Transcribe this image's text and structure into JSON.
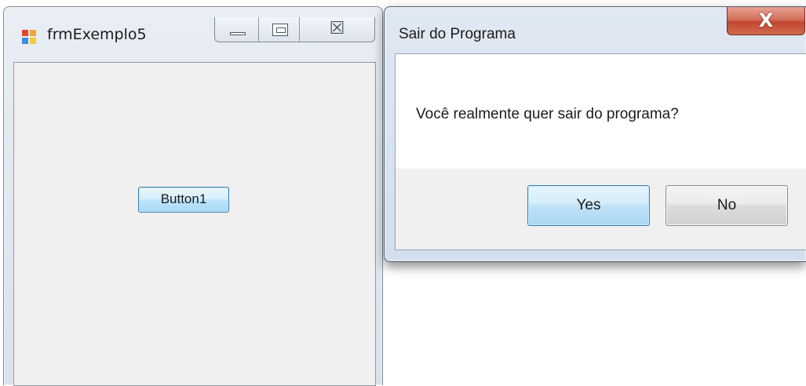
{
  "form": {
    "title": "frmExemplo5",
    "close_glyph": "☒",
    "icon": "windows-form-icon",
    "button1_label": "Button1"
  },
  "dialog": {
    "title": "Sair do Programa",
    "close_glyph": "X",
    "message": "Você realmente quer sair do programa?",
    "yes_label": "Yes",
    "no_label": "No"
  },
  "colors": {
    "close_button_red": "#c2472f",
    "focused_button_blue": "#3c7fb1",
    "client_background": "#f0f0f0"
  }
}
